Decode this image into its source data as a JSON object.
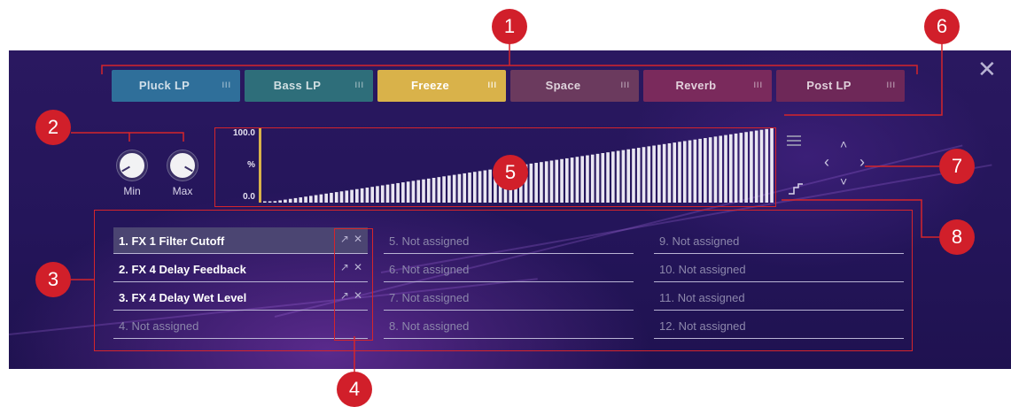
{
  "tabs": [
    {
      "label": "Pluck LP",
      "color": "#2f6f9a",
      "active": false
    },
    {
      "label": "Bass LP",
      "color": "#2e6e7a",
      "active": false
    },
    {
      "label": "Freeze",
      "color": "#d9b24a",
      "active": true
    },
    {
      "label": "Space",
      "color": "#6b3a5e",
      "active": false
    },
    {
      "label": "Reverb",
      "color": "#7a2a5c",
      "active": false
    },
    {
      "label": "Post LP",
      "color": "#6e2858",
      "active": false
    }
  ],
  "tab_grip": "III",
  "close_label": "✕",
  "knobs": {
    "min_label": "Min",
    "max_label": "Max"
  },
  "chart_data": {
    "type": "bar",
    "ylim": [
      0,
      100
    ],
    "y_tick_top": "100.0",
    "y_unit": "%",
    "y_tick_bottom": "0.0",
    "bar_count": 100,
    "values_description": "linear ramp",
    "start_value": 0,
    "end_value": 100,
    "bar_color": "#e9e6f2",
    "cursor_color": "#d9b24a"
  },
  "nav": {
    "up": "˄",
    "down": "˅",
    "left": "‹",
    "right": "›"
  },
  "slots": [
    {
      "label": "1. FX 1 Filter Cutoff",
      "assigned": true,
      "selected": true
    },
    {
      "label": "2. FX 4 Delay Feedback",
      "assigned": true,
      "selected": false
    },
    {
      "label": "3. FX 4 Delay Wet Level",
      "assigned": true,
      "selected": false
    },
    {
      "label": "4. Not assigned",
      "assigned": false,
      "selected": false
    },
    {
      "label": "5. Not assigned",
      "assigned": false,
      "selected": false
    },
    {
      "label": "6. Not assigned",
      "assigned": false,
      "selected": false
    },
    {
      "label": "7. Not assigned",
      "assigned": false,
      "selected": false
    },
    {
      "label": "8. Not assigned",
      "assigned": false,
      "selected": false
    },
    {
      "label": "9. Not assigned",
      "assigned": false,
      "selected": false
    },
    {
      "label": "10. Not assigned",
      "assigned": false,
      "selected": false
    },
    {
      "label": "11. Not assigned",
      "assigned": false,
      "selected": false
    },
    {
      "label": "12. Not assigned",
      "assigned": false,
      "selected": false
    }
  ],
  "slot_icons": {
    "link": "↗",
    "remove": "✕"
  },
  "callouts": [
    "1",
    "2",
    "3",
    "4",
    "5",
    "6",
    "7",
    "8"
  ],
  "callout_color": "#d11f2a"
}
